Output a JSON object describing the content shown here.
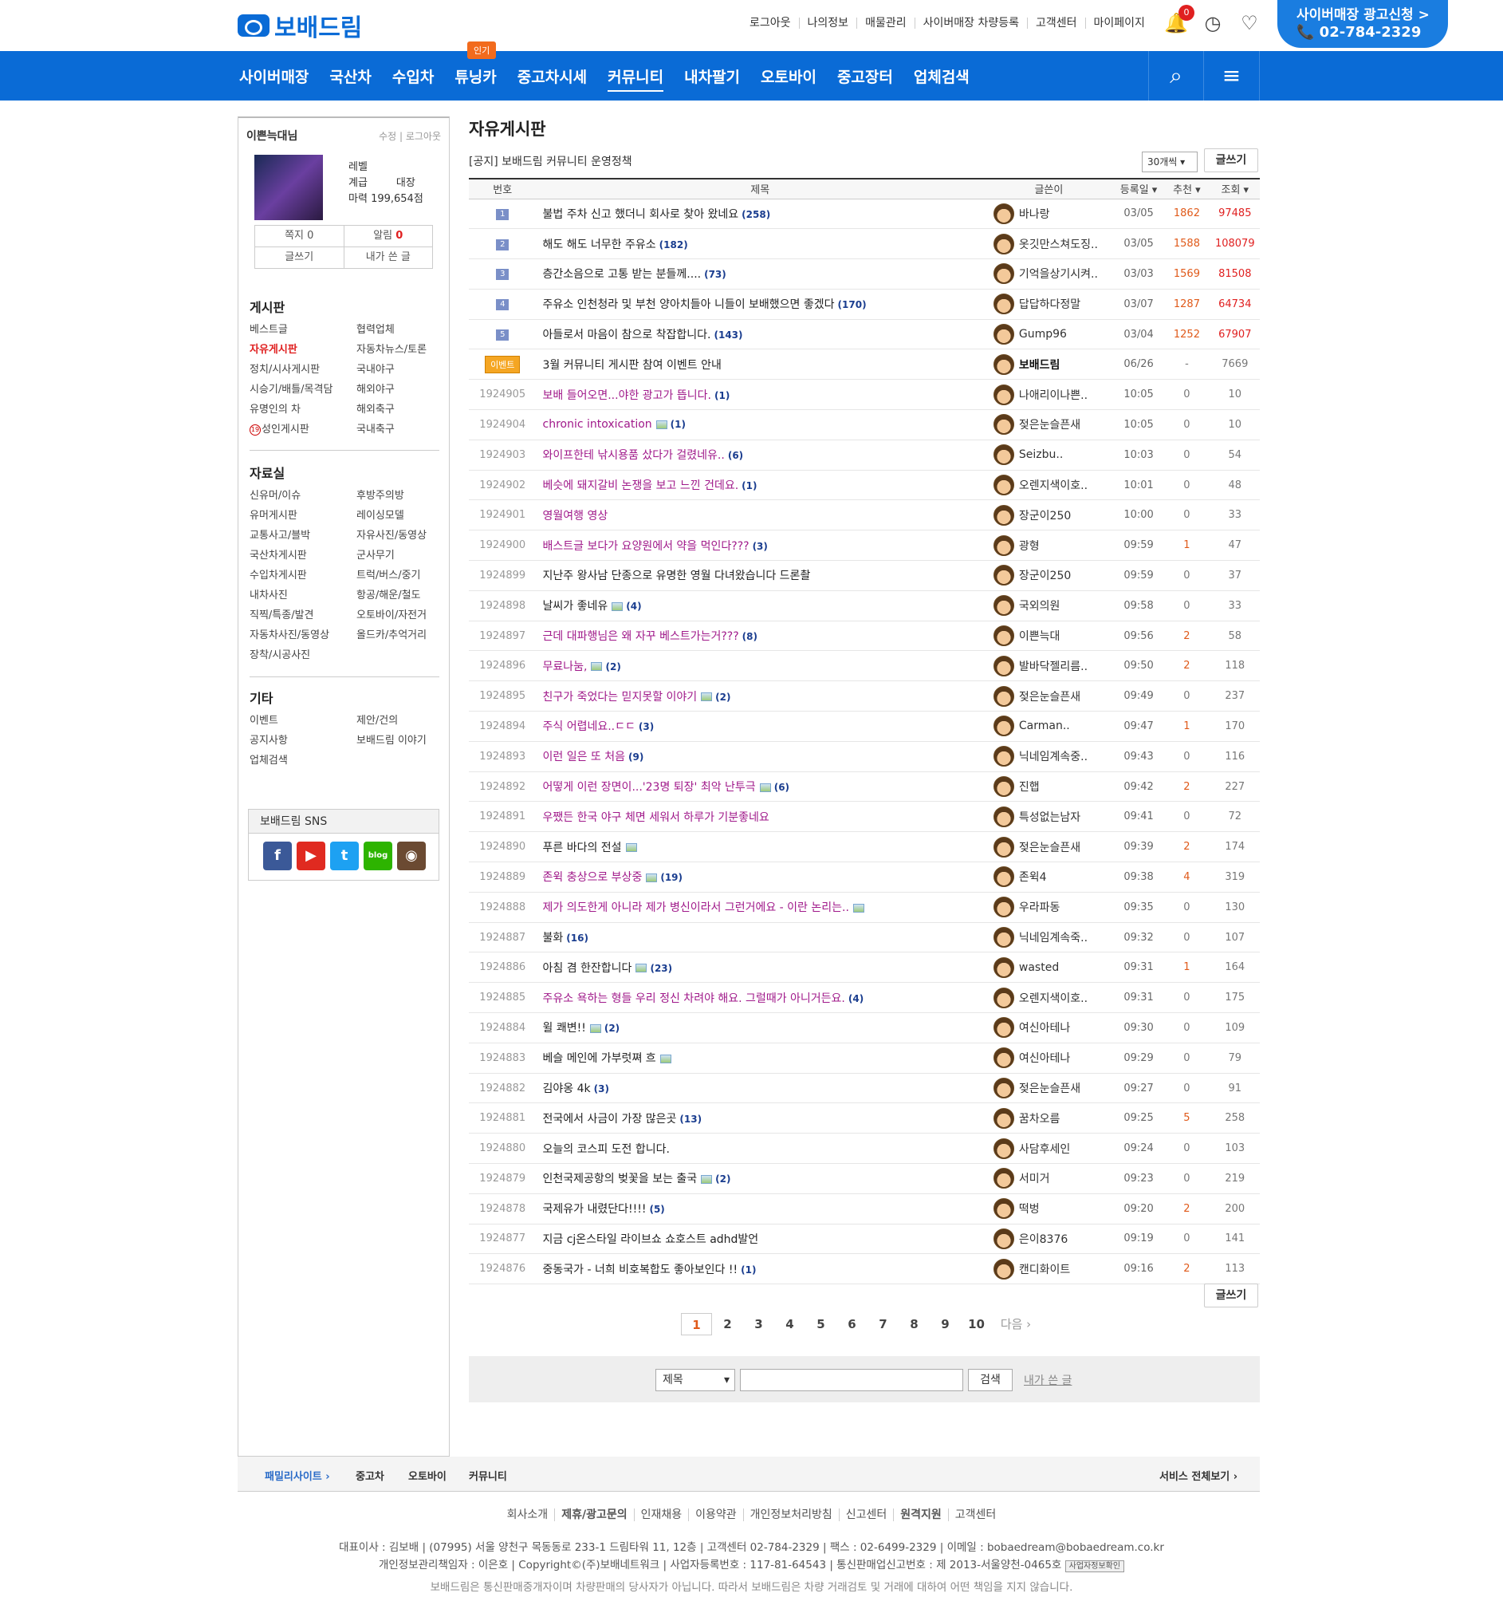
{
  "header": {
    "logo": "보배드림",
    "links": [
      "로그아웃",
      "나의정보",
      "매물관리",
      "사이버매장 차량등록",
      "고객센터",
      "마이페이지"
    ],
    "notif_count": "0",
    "ad_line1": "사이버매장 광고신청 >",
    "ad_line2": "📞 02-784-2329"
  },
  "nav": {
    "items": [
      "사이버매장",
      "국산차",
      "수입차",
      "튜닝카",
      "중고차시세",
      "커뮤니티",
      "내차팔기",
      "오토바이",
      "중고장터",
      "업체검색"
    ],
    "hot": "인기"
  },
  "profile": {
    "name": "이쁜늑대님",
    "edit": "수정 | 로그아웃",
    "level": "레벨",
    "rank": "계급",
    "rank_val": "대장",
    "magic": "마력",
    "magic_val": "199,654점",
    "note": "쪽지 0",
    "alarm": "알림",
    "alarm_val": "0",
    "write": "글쓰기",
    "mine": "내가 쓴 글"
  },
  "side": {
    "board_title": "게시판",
    "board": [
      "베스트글",
      "협력업체",
      "자유게시판",
      "자동차뉴스/토론",
      "정치/시사게시판",
      "국내야구",
      "시승기/배틀/목격담",
      "해외야구",
      "유명인의 차",
      "해외축구",
      "성인게시판",
      "국내축구"
    ],
    "data_title": "자료실",
    "data": [
      "신유머/이슈",
      "후방주의방",
      "유머게시판",
      "레이싱모델",
      "교통사고/블박",
      "자유사진/동영상",
      "국산차게시판",
      "군사무기",
      "수입차게시판",
      "트럭/버스/중기",
      "내차사진",
      "항공/해운/철도",
      "직찍/특종/발견",
      "오토바이/자전거",
      "자동차사진/동영상",
      "올드카/추억거리",
      "장착/시공사진",
      ""
    ],
    "etc_title": "기타",
    "etc": [
      "이벤트",
      "제안/건의",
      "공지사항",
      "보배드림 이야기",
      "업체검색",
      ""
    ],
    "sns": "보배드림 SNS",
    "adult_badge": "19"
  },
  "board": {
    "title": "자유게시판",
    "notice": "[공지] 보배드림 커뮤니티 운영정책",
    "per_page": "30개씩",
    "write": "글쓰기",
    "headers": {
      "no": "번호",
      "title": "제목",
      "author": "글쓴이",
      "date": "등록일 ▾",
      "rec": "추천 ▾",
      "view": "조회 ▾"
    },
    "rows": [
      {
        "no": "1",
        "best": true,
        "title": "불법 주차 신고 했더니 회사로 찾아 왔네요",
        "cm": "(258)",
        "author": "바나랑",
        "date": "03/05",
        "rec": "1862",
        "view": "97485"
      },
      {
        "no": "2",
        "best": true,
        "title": "해도 해도 너무한 주유소",
        "cm": "(182)",
        "author": "옷깃만스쳐도징..",
        "date": "03/05",
        "rec": "1588",
        "view": "108079"
      },
      {
        "no": "3",
        "best": true,
        "title": "층간소음으로 고통 받는 분들께....",
        "cm": "(73)",
        "author": "기억을상기시켜..",
        "date": "03/03",
        "rec": "1569",
        "view": "81508"
      },
      {
        "no": "4",
        "best": true,
        "title": "주유소 인천청라 및 부천 양아치들아 니들이 보배했으면 좋겠다",
        "cm": "(170)",
        "author": "답답하다정말",
        "date": "03/07",
        "rec": "1287",
        "view": "64734"
      },
      {
        "no": "5",
        "best": true,
        "title": "아들로서 마음이 참으로 착잡합니다.",
        "cm": "(143)",
        "author": "Gump96",
        "date": "03/04",
        "rec": "1252",
        "view": "67907"
      },
      {
        "no": "이벤트",
        "event": true,
        "title": "3월 커뮤니티 게시판 참여 이벤트 안내",
        "cm": "",
        "author": "보배드림",
        "date": "06/26",
        "rec": "-",
        "view": "7669"
      },
      {
        "no": "1924905",
        "p": true,
        "title": "보배 들어오면...야한 광고가 뜹니다.",
        "cm": "(1)",
        "author": "나애리이나쁜..",
        "date": "10:05",
        "rec": "0",
        "view": "10"
      },
      {
        "no": "1924904",
        "p": true,
        "pic": true,
        "title": "chronic intoxication",
        "cm": "(1)",
        "author": "젖은눈슬픈새",
        "date": "10:05",
        "rec": "0",
        "view": "10"
      },
      {
        "no": "1924903",
        "p": true,
        "title": "와이프한테 낚시용품 샀다가 걸렸네유..",
        "cm": "(6)",
        "author": "Seizbu..",
        "date": "10:03",
        "rec": "0",
        "view": "54"
      },
      {
        "no": "1924902",
        "p": true,
        "title": "베슷에 돼지갈비 논쟁을 보고 느낀 건데요.",
        "cm": "(1)",
        "author": "오렌지색이호..",
        "date": "10:01",
        "rec": "0",
        "view": "48"
      },
      {
        "no": "1924901",
        "p": true,
        "title": "영월여행 영상",
        "cm": "",
        "author": "장군이250",
        "date": "10:00",
        "rec": "0",
        "view": "33"
      },
      {
        "no": "1924900",
        "p": true,
        "title": "배스트글 보다가 요양원에서 약을 먹인다???",
        "cm": "(3)",
        "author": "광형",
        "date": "09:59",
        "rec": "1",
        "view": "47"
      },
      {
        "no": "1924899",
        "title": "지난주 왕사남 단종으로 유명한 영월 다녀왔습니다 드론촬",
        "cm": "",
        "author": "장군이250",
        "date": "09:59",
        "rec": "0",
        "view": "37"
      },
      {
        "no": "1924898",
        "pic": true,
        "title": "날씨가 좋네유",
        "cm": "(4)",
        "author": "국외의원",
        "date": "09:58",
        "rec": "0",
        "view": "33"
      },
      {
        "no": "1924897",
        "p": true,
        "title": "근데 대파행님은 왜 자꾸 베스트가는거???",
        "cm": "(8)",
        "author": "이쁜늑대",
        "date": "09:56",
        "rec": "2",
        "view": "58"
      },
      {
        "no": "1924896",
        "p": true,
        "pic": true,
        "title": "무료나눔,",
        "cm": "(2)",
        "author": "발바닥젤리름..",
        "date": "09:50",
        "rec": "2",
        "view": "118"
      },
      {
        "no": "1924895",
        "p": true,
        "pic": true,
        "title": "친구가 죽었다는 믿지못할 이야기",
        "cm": "(2)",
        "author": "젖은눈슬픈새",
        "date": "09:49",
        "rec": "0",
        "view": "237"
      },
      {
        "no": "1924894",
        "p": true,
        "title": "주식 어렵네요..ㄷㄷ",
        "cm": "(3)",
        "author": "Carman..",
        "date": "09:47",
        "rec": "1",
        "view": "170"
      },
      {
        "no": "1924893",
        "p": true,
        "title": "이런 일은 또 처음",
        "cm": "(9)",
        "author": "닉네임계속중..",
        "date": "09:43",
        "rec": "0",
        "view": "116"
      },
      {
        "no": "1924892",
        "p": true,
        "pic": true,
        "title": "어떻게 이런 장면이...'23명 퇴장' 최악 난투극",
        "cm": "(6)",
        "author": "진햅",
        "date": "09:42",
        "rec": "2",
        "view": "227"
      },
      {
        "no": "1924891",
        "p": true,
        "title": "우쨌든 한국 야구 체면 세워서 하루가 기분좋네요",
        "cm": "",
        "author": "특성없는남자",
        "date": "09:41",
        "rec": "0",
        "view": "72"
      },
      {
        "no": "1924890",
        "pic": true,
        "title": "푸른 바다의 전설",
        "cm": "",
        "author": "젖은눈슬픈새",
        "date": "09:39",
        "rec": "2",
        "view": "174"
      },
      {
        "no": "1924889",
        "p": true,
        "pic": true,
        "title": "존윅 충상으로 부상중",
        "cm": "(19)",
        "author": "존윅4",
        "date": "09:38",
        "rec": "4",
        "view": "319"
      },
      {
        "no": "1924888",
        "p": true,
        "pic": true,
        "title": "제가 의도한게 아니라 제가 병신이라서 그런거에요 - 이란 논리는..",
        "cm": "",
        "author": "우라파동",
        "date": "09:35",
        "rec": "0",
        "view": "130"
      },
      {
        "no": "1924887",
        "title": "불화",
        "cm": "(16)",
        "author": "닉네임계속죽..",
        "date": "09:32",
        "rec": "0",
        "view": "107"
      },
      {
        "no": "1924886",
        "pic": true,
        "title": "아침 겸 한잔합니다",
        "cm": "(23)",
        "author": "wasted",
        "date": "09:31",
        "rec": "1",
        "view": "164"
      },
      {
        "no": "1924885",
        "p": true,
        "title": "주유소 욕하는 형들 우리 정신 차려야 해요. 그럴때가 아니거든요.",
        "cm": "(4)",
        "author": "오렌지색이호..",
        "date": "09:31",
        "rec": "0",
        "view": "175"
      },
      {
        "no": "1924884",
        "pic": true,
        "title": "윌 쾌변!!",
        "cm": "(2)",
        "author": "여신아테나",
        "date": "09:30",
        "rec": "0",
        "view": "109"
      },
      {
        "no": "1924883",
        "pic": true,
        "title": "베슬 메인에 가부럿쪄 흐",
        "cm": "",
        "author": "여신아테나",
        "date": "09:29",
        "rec": "0",
        "view": "79"
      },
      {
        "no": "1924882",
        "title": "김야옹 4k",
        "cm": "(3)",
        "author": "젖은눈슬픈새",
        "date": "09:27",
        "rec": "0",
        "view": "91"
      },
      {
        "no": "1924881",
        "title": "전국에서 사금이 가장 많은곳",
        "cm": "(13)",
        "author": "꿈차오름",
        "date": "09:25",
        "rec": "5",
        "view": "258"
      },
      {
        "no": "1924880",
        "title": "오늘의 코스피 도전 합니다.",
        "cm": "",
        "author": "사담후세인",
        "date": "09:24",
        "rec": "0",
        "view": "103"
      },
      {
        "no": "1924879",
        "pic": true,
        "title": "인천국제공항의 벚꽃을 보는 출국",
        "cm": "(2)",
        "author": "서미거",
        "date": "09:23",
        "rec": "0",
        "view": "219"
      },
      {
        "no": "1924878",
        "title": "국제유가 내렸단다!!!!",
        "cm": "(5)",
        "author": "떡벙",
        "date": "09:20",
        "rec": "2",
        "view": "200"
      },
      {
        "no": "1924877",
        "title": "지금 cj온스타일 라이브쇼 쇼호스트 adhd발언",
        "cm": "",
        "author": "은이8376",
        "date": "09:19",
        "rec": "0",
        "view": "141"
      },
      {
        "no": "1924876",
        "title": "중동국가 - 너희 비호복합도 좋아보인다 !!",
        "cm": "(1)",
        "author": "캔디화이트",
        "date": "09:16",
        "rec": "2",
        "view": "113"
      }
    ],
    "pages": [
      "1",
      "2",
      "3",
      "4",
      "5",
      "6",
      "7",
      "8",
      "9",
      "10"
    ],
    "next": "다음 ›",
    "search_type": "제목",
    "search_btn": "검색",
    "my_posts": "내가 쓴 글"
  },
  "footer": {
    "family": "패밀리사이트 ›",
    "fam_items": [
      "중고차",
      "오토바이",
      "커뮤니티"
    ],
    "all": "서비스 전체보기 ›",
    "links": [
      "회사소개",
      "제휴/광고문의",
      "인재채용",
      "이용약관",
      "개인정보처리방침",
      "신고센터",
      "원격지원",
      "고객센터"
    ],
    "info1": "대표이사 : 김보배 | (07995) 서울 양천구 목동동로 233-1 드림타워 11, 12층 | 고객센터 02-784-2329 | 팩스 : 02-6499-2329 | 이메일 : bobaedream@bobaedream.co.kr",
    "info2": "개인정보관리책임자 : 이은호 | Copyright©(주)보배네트워크 | 사업자등록번호 : 117-81-64543 | 통신판매업신고번호 : 제 2013-서울양천-0465호",
    "info2_badge": "사업자정보확인",
    "info3": "보배드림은 통신판매중개자이며 차량판매의 당사자가 아닙니다. 따라서 보배드림은 차량 거래검토 및 거래에 대하여 어떤 책임을 지지 않습니다."
  }
}
